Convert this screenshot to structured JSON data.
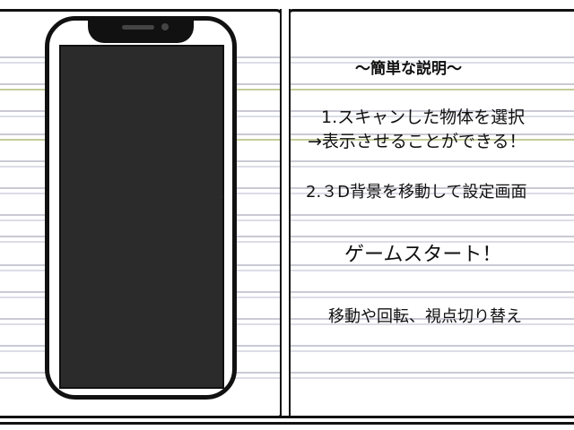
{
  "instructions": {
    "title": "～簡単な説明～",
    "step1_line1": "1.スキャンした物体を選択",
    "step1_line2": "→表示させることができる！",
    "step2": "2.３D背景を移動して設定画面",
    "start": "ゲームスタート！",
    "controls": "移動や回転、視点切り替え"
  },
  "colors": {
    "outline": "#111111",
    "screen": "#2b2b2b",
    "rule_line": "#c9cad4",
    "rule_accent": "#c5cc9a"
  }
}
